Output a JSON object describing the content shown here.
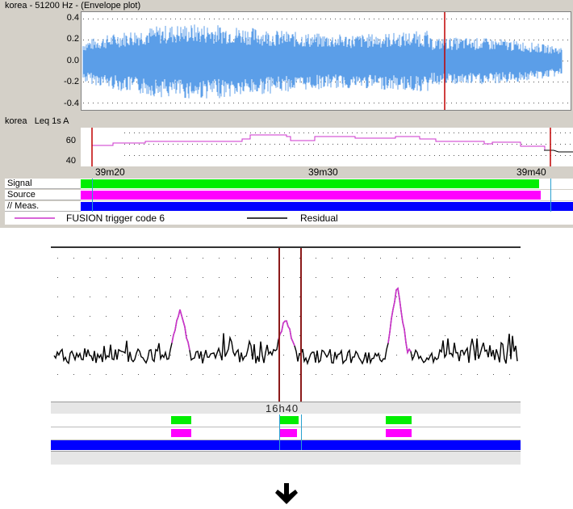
{
  "envelope": {
    "title": "korea - 51200 Hz - (Envelope plot)",
    "yticks": [
      "0.4",
      "0.2",
      "0.0",
      "-0.2",
      "-0.4"
    ],
    "color": "#5b9ee8"
  },
  "leq": {
    "label_name": "korea",
    "label_metric": "Leq 1s  A",
    "yticks": [
      "60",
      "40"
    ]
  },
  "xaxis": {
    "ticks": [
      "39m20",
      "39m30",
      "39m40"
    ]
  },
  "tracks": [
    {
      "label": "Signal",
      "color": "#00ee00"
    },
    {
      "label": "Source",
      "color": "#ff00ff"
    },
    {
      "label": "// Meas.",
      "color": "#0000ff"
    }
  ],
  "legend": {
    "fusion": "FUSION trigger code 6",
    "residual": "Residual",
    "fusion_color": "#cc33cc",
    "residual_color": "#000000"
  },
  "zoom": {
    "time_label": "16h40",
    "signal_color": "#00ee00",
    "source_color": "#ff00ff",
    "meas_color": "#0000ff"
  },
  "arrow_icon": "down-arrow-icon"
}
